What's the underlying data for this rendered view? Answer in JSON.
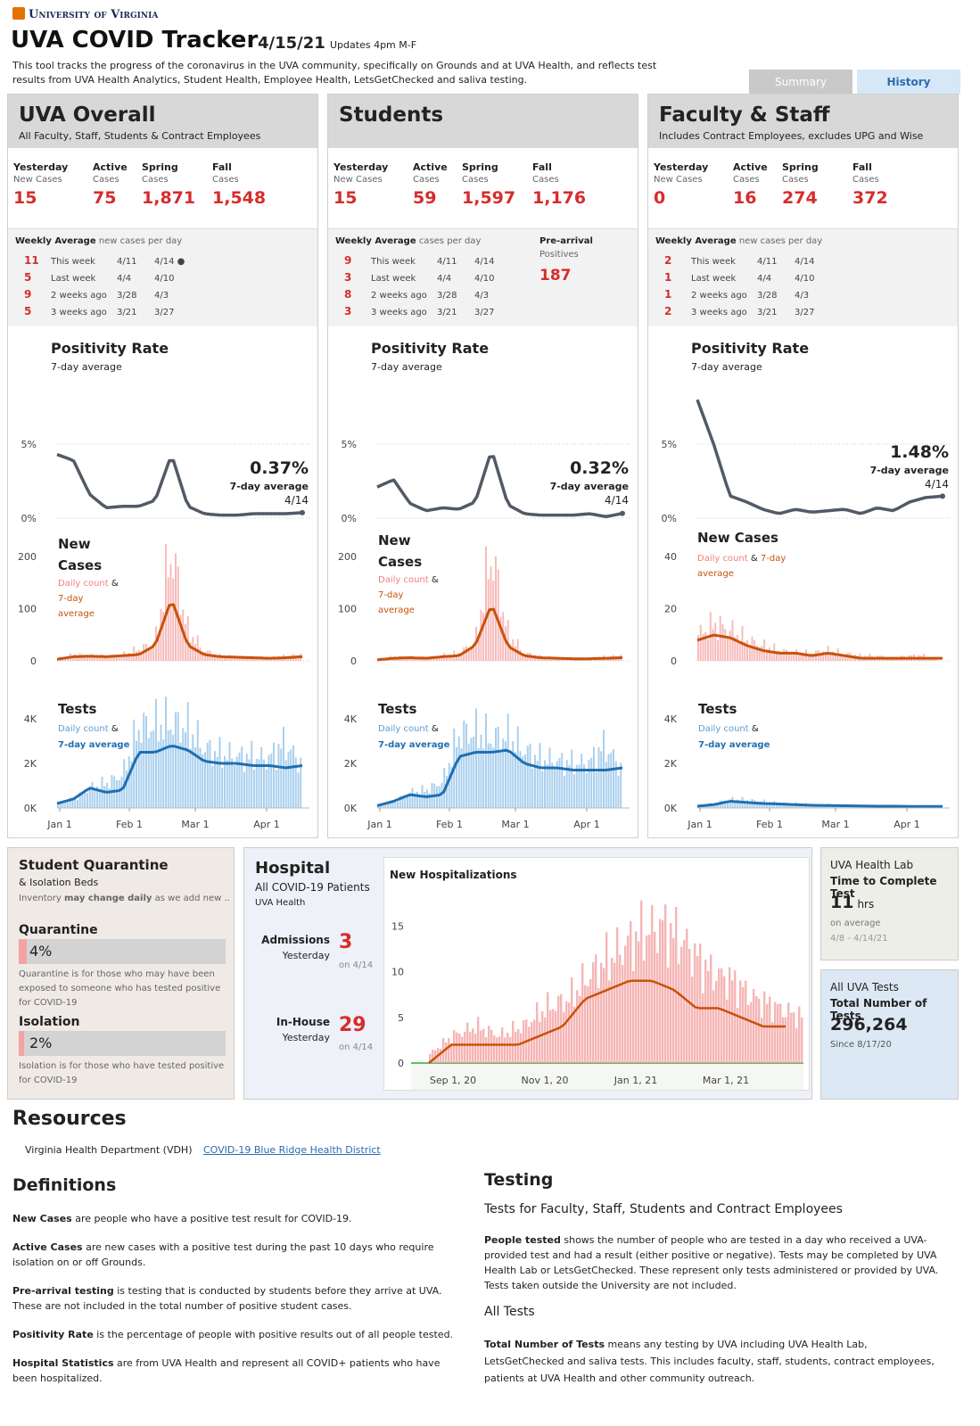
{
  "header": {
    "university": "University of Virginia",
    "title": "UVA COVID Tracker",
    "date": "4/15/21",
    "updates": "Updates 4pm M-F",
    "description_line1": "This tool tracks the progress of the coronavirus in the UVA community, specifically on Grounds and at UVA Health, and reflects test",
    "description_line2": "results from UVA Health Analytics, Student Health, Employee Health, LetsGetChecked and saliva testing.",
    "tabs": [
      "Summary",
      "History"
    ]
  },
  "panels": [
    {
      "title": "UVA Overall",
      "subtitle": "All Faculty, Staff, Students & Contract Employees",
      "stats": [
        {
          "label": "Yesterday",
          "sub": "New Cases",
          "value": "15"
        },
        {
          "label": "Active",
          "sub": "Cases",
          "value": "75"
        },
        {
          "label": "Spring",
          "sub": "Cases",
          "value": "1,871"
        },
        {
          "label": "Fall",
          "sub": "Cases",
          "value": "1,548"
        }
      ],
      "weekly_title": "Weekly Average",
      "weekly_note": "new cases per day",
      "weekly": [
        {
          "n": "11",
          "label": "This week",
          "from": "4/11",
          "to": "4/14 ●"
        },
        {
          "n": "5",
          "label": "Last week",
          "from": "4/4",
          "to": "4/10"
        },
        {
          "n": "9",
          "label": "2 weeks ago",
          "from": "3/28",
          "to": "4/3"
        },
        {
          "n": "5",
          "label": "3 weeks ago",
          "from": "3/21",
          "to": "3/27"
        }
      ],
      "prearrival": null,
      "positivity": {
        "value": "0.37%",
        "label": "7-day average",
        "date": "4/14"
      }
    },
    {
      "title": "Students",
      "subtitle": "",
      "stats": [
        {
          "label": "Yesterday",
          "sub": "New Cases",
          "value": "15"
        },
        {
          "label": "Active",
          "sub": "Cases",
          "value": "59"
        },
        {
          "label": "Spring",
          "sub": "Cases",
          "value": "1,597"
        },
        {
          "label": "Fall",
          "sub": "Cases",
          "value": "1,176"
        }
      ],
      "weekly_title": "Weekly Average",
      "weekly_note": "cases per day",
      "weekly": [
        {
          "n": "9",
          "label": "This week",
          "from": "4/11",
          "to": "4/14"
        },
        {
          "n": "3",
          "label": "Last week",
          "from": "4/4",
          "to": "4/10"
        },
        {
          "n": "8",
          "label": "2 weeks ago",
          "from": "3/28",
          "to": "4/3"
        },
        {
          "n": "3",
          "label": "3 weeks ago",
          "from": "3/21",
          "to": "3/27"
        }
      ],
      "prearrival": {
        "title": "Pre-arrival",
        "sub": "Positives",
        "value": "187"
      },
      "positivity": {
        "value": "0.32%",
        "label": "7-day average",
        "date": "4/14"
      }
    },
    {
      "title": "Faculty & Staff",
      "subtitle": "Includes Contract Employees, excludes UPG and Wise",
      "stats": [
        {
          "label": "Yesterday",
          "sub": "New Cases",
          "value": "0"
        },
        {
          "label": "Active",
          "sub": "Cases",
          "value": "16"
        },
        {
          "label": "Spring",
          "sub": "Cases",
          "value": "274"
        },
        {
          "label": "Fall",
          "sub": "Cases",
          "value": "372"
        }
      ],
      "weekly_title": "Weekly Average",
      "weekly_note": "new cases per day",
      "weekly": [
        {
          "n": "2",
          "label": "This week",
          "from": "4/11",
          "to": "4/14"
        },
        {
          "n": "1",
          "label": "Last week",
          "from": "4/4",
          "to": "4/10"
        },
        {
          "n": "1",
          "label": "2 weeks ago",
          "from": "3/28",
          "to": "4/3"
        },
        {
          "n": "2",
          "label": "3 weeks ago",
          "from": "3/21",
          "to": "3/27"
        }
      ],
      "prearrival": null,
      "positivity": {
        "value": "1.48%",
        "label": "7-day average",
        "date": "4/14"
      }
    }
  ],
  "chart_text": {
    "positivity_title": "Positivity Rate",
    "positivity_sub": "7-day average",
    "newcases_title_1": "New",
    "newcases_title_2": "Cases",
    "newcases_title_full": "New Cases",
    "daily_count": "Daily count",
    "amp": "&",
    "seven_day": "7-day",
    "average": "average",
    "seven_day_average": "7-day average",
    "tests_title": "Tests",
    "x_ticks": [
      "Jan 1",
      "Feb 1",
      "Mar 1",
      "Apr 1"
    ]
  },
  "chart_data": [
    {
      "type": "line",
      "title": "Positivity Rate",
      "panel": "UVA Overall",
      "unit": "%",
      "ylim": [
        0,
        5
      ],
      "yticks": [
        "0%",
        "5%"
      ],
      "x": [
        "Jan 1",
        "Jan 8",
        "Jan 15",
        "Jan 22",
        "Jan 29",
        "Feb 5",
        "Feb 12",
        "Feb 19",
        "Feb 26",
        "Mar 5",
        "Mar 12",
        "Mar 19",
        "Mar 26",
        "Apr 2",
        "Apr 9",
        "Apr 14"
      ],
      "values": [
        4.3,
        3.9,
        1.6,
        0.7,
        0.8,
        0.8,
        1.2,
        4.3,
        0.8,
        0.3,
        0.2,
        0.2,
        0.3,
        0.3,
        0.3,
        0.37
      ]
    },
    {
      "type": "bar+line",
      "title": "New Cases",
      "panel": "UVA Overall",
      "ylim": [
        0,
        225
      ],
      "yticks": [
        "0",
        "100",
        "200"
      ],
      "x": [
        "Jan 1",
        "Jan 8",
        "Jan 15",
        "Jan 22",
        "Jan 29",
        "Feb 5",
        "Feb 12",
        "Feb 19",
        "Feb 26",
        "Mar 5",
        "Mar 12",
        "Mar 19",
        "Mar 26",
        "Apr 2",
        "Apr 9",
        "Apr 14"
      ],
      "series": [
        {
          "name": "Daily count",
          "values": [
            5,
            12,
            10,
            8,
            12,
            22,
            35,
            215,
            60,
            20,
            9,
            8,
            7,
            6,
            9,
            12
          ]
        },
        {
          "name": "7-day average",
          "values": [
            3,
            8,
            9,
            8,
            10,
            12,
            30,
            120,
            30,
            12,
            8,
            7,
            6,
            5,
            6,
            8
          ]
        }
      ]
    },
    {
      "type": "bar+line",
      "title": "Tests",
      "panel": "UVA Overall",
      "ylim": [
        0,
        4000
      ],
      "yticks": [
        "0K",
        "2K",
        "4K"
      ],
      "x": [
        "Jan 1",
        "Jan 8",
        "Jan 15",
        "Jan 22",
        "Jan 29",
        "Feb 5",
        "Feb 12",
        "Feb 19",
        "Feb 26",
        "Mar 5",
        "Mar 12",
        "Mar 19",
        "Mar 26",
        "Apr 2",
        "Apr 9",
        "Apr 14"
      ],
      "series": [
        {
          "name": "Daily count",
          "values": [
            200,
            400,
            900,
            1100,
            1500,
            3600,
            3700,
            3800,
            3600,
            2700,
            2400,
            2300,
            2300,
            2200,
            2900,
            2000
          ]
        },
        {
          "name": "7-day average",
          "values": [
            200,
            400,
            900,
            700,
            800,
            2500,
            2500,
            2800,
            2600,
            2100,
            2000,
            2000,
            1900,
            1900,
            1800,
            1900
          ]
        }
      ]
    },
    {
      "type": "line",
      "title": "Positivity Rate",
      "panel": "Students",
      "unit": "%",
      "ylim": [
        0,
        5
      ],
      "yticks": [
        "0%",
        "5%"
      ],
      "x": [
        "Jan 1",
        "Jan 8",
        "Jan 15",
        "Jan 22",
        "Jan 29",
        "Feb 5",
        "Feb 12",
        "Feb 19",
        "Feb 26",
        "Mar 5",
        "Mar 12",
        "Mar 19",
        "Mar 26",
        "Apr 2",
        "Apr 9",
        "Apr 14"
      ],
      "values": [
        2.1,
        2.6,
        1.0,
        0.5,
        0.7,
        0.6,
        1.1,
        4.6,
        0.9,
        0.3,
        0.2,
        0.2,
        0.2,
        0.3,
        0.1,
        0.32
      ]
    },
    {
      "type": "bar+line",
      "title": "New Cases",
      "panel": "Students",
      "ylim": [
        0,
        225
      ],
      "yticks": [
        "0",
        "100",
        "200"
      ],
      "x": [
        "Jan 1",
        "Jan 8",
        "Jan 15",
        "Jan 22",
        "Jan 29",
        "Feb 5",
        "Feb 12",
        "Feb 19",
        "Feb 26",
        "Mar 5",
        "Mar 12",
        "Mar 19",
        "Mar 26",
        "Apr 2",
        "Apr 9",
        "Apr 14"
      ],
      "series": [
        {
          "name": "Daily count",
          "values": [
            3,
            8,
            7,
            6,
            10,
            15,
            35,
            210,
            55,
            15,
            8,
            6,
            5,
            5,
            8,
            10
          ]
        },
        {
          "name": "7-day average",
          "values": [
            2,
            5,
            6,
            5,
            8,
            10,
            30,
            110,
            28,
            10,
            6,
            5,
            4,
            4,
            5,
            6
          ]
        }
      ]
    },
    {
      "type": "bar+line",
      "title": "Tests",
      "panel": "Students",
      "ylim": [
        0,
        4000
      ],
      "yticks": [
        "0K",
        "2K",
        "4K"
      ],
      "x": [
        "Jan 1",
        "Jan 8",
        "Jan 15",
        "Jan 22",
        "Jan 29",
        "Feb 5",
        "Feb 12",
        "Feb 19",
        "Feb 26",
        "Mar 5",
        "Mar 12",
        "Mar 19",
        "Mar 26",
        "Apr 2",
        "Apr 9",
        "Apr 14"
      ],
      "series": [
        {
          "name": "Daily count",
          "values": [
            100,
            300,
            700,
            800,
            1200,
            3300,
            3400,
            3100,
            3200,
            2600,
            2200,
            2100,
            2000,
            2000,
            2800,
            1800
          ]
        },
        {
          "name": "7-day average",
          "values": [
            100,
            300,
            600,
            500,
            600,
            2300,
            2500,
            2500,
            2600,
            2000,
            1800,
            1800,
            1700,
            1700,
            1700,
            1800
          ]
        }
      ]
    },
    {
      "type": "line",
      "title": "Positivity Rate",
      "panel": "Faculty & Staff",
      "unit": "%",
      "ylim": [
        0,
        5
      ],
      "yticks": [
        "0%",
        "5%"
      ],
      "x": [
        "Jan 1",
        "Jan 8",
        "Jan 15",
        "Jan 22",
        "Jan 29",
        "Feb 5",
        "Feb 12",
        "Feb 19",
        "Feb 26",
        "Mar 5",
        "Mar 12",
        "Mar 19",
        "Mar 26",
        "Apr 2",
        "Apr 9",
        "Apr 14"
      ],
      "values": [
        8.0,
        5.0,
        1.5,
        1.1,
        0.6,
        0.3,
        0.6,
        0.4,
        0.5,
        0.6,
        0.3,
        0.7,
        0.5,
        1.1,
        1.4,
        1.48
      ]
    },
    {
      "type": "bar+line",
      "title": "New Cases",
      "panel": "Faculty & Staff",
      "ylim": [
        0,
        45
      ],
      "yticks": [
        "0",
        "20",
        "40"
      ],
      "x": [
        "Jan 1",
        "Jan 8",
        "Jan 15",
        "Jan 22",
        "Jan 29",
        "Feb 5",
        "Feb 12",
        "Feb 19",
        "Feb 26",
        "Mar 5",
        "Mar 12",
        "Mar 19",
        "Mar 26",
        "Apr 2",
        "Apr 9",
        "Apr 14"
      ],
      "series": [
        {
          "name": "Daily count",
          "values": [
            10,
            14,
            12,
            8,
            6,
            4,
            3,
            3,
            4,
            3,
            2,
            2,
            1,
            2,
            2,
            0
          ]
        },
        {
          "name": "7-day average",
          "values": [
            8,
            10,
            9,
            6,
            4,
            3,
            3,
            2,
            3,
            2,
            1,
            1,
            1,
            1,
            1,
            1
          ]
        }
      ]
    },
    {
      "type": "bar+line",
      "title": "Tests",
      "panel": "Faculty & Staff",
      "ylim": [
        0,
        4000
      ],
      "yticks": [
        "0K",
        "2K",
        "4K"
      ],
      "x": [
        "Jan 1",
        "Jan 8",
        "Jan 15",
        "Jan 22",
        "Jan 29",
        "Feb 5",
        "Feb 12",
        "Feb 19",
        "Feb 26",
        "Mar 5",
        "Mar 12",
        "Mar 19",
        "Mar 26",
        "Apr 2",
        "Apr 9",
        "Apr 14"
      ],
      "series": [
        {
          "name": "Daily count",
          "values": [
            100,
            200,
            400,
            350,
            300,
            200,
            200,
            150,
            150,
            100,
            100,
            100,
            100,
            100,
            100,
            80
          ]
        },
        {
          "name": "7-day average",
          "values": [
            80,
            150,
            300,
            250,
            200,
            180,
            150,
            120,
            110,
            100,
            90,
            80,
            80,
            70,
            70,
            70
          ]
        }
      ]
    },
    {
      "type": "bar+line",
      "title": "New Hospitalizations",
      "ylim": [
        0,
        16
      ],
      "yticks": [
        "0",
        "5",
        "10",
        "15"
      ],
      "x_ticks": [
        "Sep 1, 20",
        "Nov 1, 20",
        "Jan 1, 21",
        "Mar 1, 21"
      ],
      "x": [
        "Aug 17",
        "Sep 1",
        "Sep 15",
        "Oct 1",
        "Oct 15",
        "Nov 1",
        "Nov 15",
        "Dec 1",
        "Dec 15",
        "Jan 1",
        "Jan 15",
        "Feb 1",
        "Feb 15",
        "Mar 1",
        "Mar 15",
        "Apr 1",
        "Apr 14"
      ],
      "series": [
        {
          "name": "Daily count",
          "values": [
            1,
            3,
            4,
            3,
            4,
            6,
            7,
            10,
            12,
            14,
            15,
            13,
            10,
            9,
            7,
            6,
            5
          ]
        },
        {
          "name": "7-day average",
          "values": [
            0,
            2,
            2,
            2,
            2,
            3,
            4,
            7,
            8,
            9,
            9,
            8,
            6,
            6,
            5,
            4,
            4
          ]
        }
      ]
    }
  ],
  "quarantine": {
    "title": "Student Quarantine",
    "subtitle": "& Isolation Beds",
    "note_pre": "Inventory ",
    "note_bold": "may change daily",
    "note_post": " as we add new ..",
    "q_title": "Quarantine",
    "q_value": "4%",
    "q_fraction": 0.04,
    "q_desc": "Quarantine is for those who may have been exposed to someone who has tested positive for COVID-19",
    "i_title": "Isolation",
    "i_value": "2%",
    "i_fraction": 0.02,
    "i_desc": "Isolation is for those who have tested positive for COVID-19"
  },
  "hospital": {
    "title": "Hospital",
    "sub1": "All COVID-19 Patients",
    "sub2": "UVA Health",
    "admissions_label": "Admissions",
    "admissions_sub": "Yesterday",
    "admissions_value": "3",
    "admissions_date": "on 4/14",
    "inhouse_label": "In-House",
    "inhouse_sub": "Yesterday",
    "inhouse_value": "29",
    "inhouse_date": "on 4/14",
    "chart_title": "New Hospitalizations"
  },
  "lab": {
    "title": "UVA Health Lab",
    "subtitle": "Time to Complete Test",
    "value": "11",
    "unit": "hrs",
    "note": "on average",
    "range": "4/8 - 4/14/21"
  },
  "alltests": {
    "title": "All UVA Tests",
    "subtitle": "Total Number of Tests",
    "value": "296,264",
    "since": "Since 8/17/20"
  },
  "resources": {
    "title": "Resources",
    "vdh": "Virginia Health Department (VDH)",
    "link": "COVID-19 Blue Ridge Health District"
  },
  "definitions": {
    "title": "Definitions",
    "items": [
      {
        "term": "New Cases",
        "text": " are people who have a positive test result for COVID-19."
      },
      {
        "term": "Active Cases",
        "text": " are new cases with a positive test during the past 10 days who require isolation on or off Grounds."
      },
      {
        "term": "Pre-arrival testing",
        "text": " is testing that is conducted by students before they arrive at UVA. These are not included in the total number of positive student cases."
      },
      {
        "term": "Positivity Rate",
        "text": " is the percentage of people with positive results out of all people tested."
      },
      {
        "term": "Hospital Statistics",
        "text": " are from UVA Health and represent all COVID+ patients who have been hospitalized."
      }
    ]
  },
  "testing": {
    "title": "Testing",
    "subtitle": "Tests for Faculty, Staff, Students and Contract Employees",
    "people_term": "People tested",
    "people_text": " shows the number of people who are tested in a day who received a UVA-provided test and had a result (either positive or negative). Tests may be completed by UVA Health Lab or LetsGetChecked. These represent only tests administered or provided by UVA. Tests taken outside the University are not included.",
    "all_title": "All Tests",
    "total_term": "Total Number of Tests",
    "total_text": " means any testing by UVA including UVA Health Lab, LetsGetChecked and saliva tests. This includes faculty, staff, students, contract employees, patients at UVA Health and other community outreach."
  },
  "colors": {
    "gray_line": "#515a66",
    "orange": "#c8520b",
    "pink": "#f4a3a3",
    "blue": "#1f6fb0",
    "lightblue": "#a9cfee",
    "red": "#d62d2d",
    "green": "#39a845"
  }
}
